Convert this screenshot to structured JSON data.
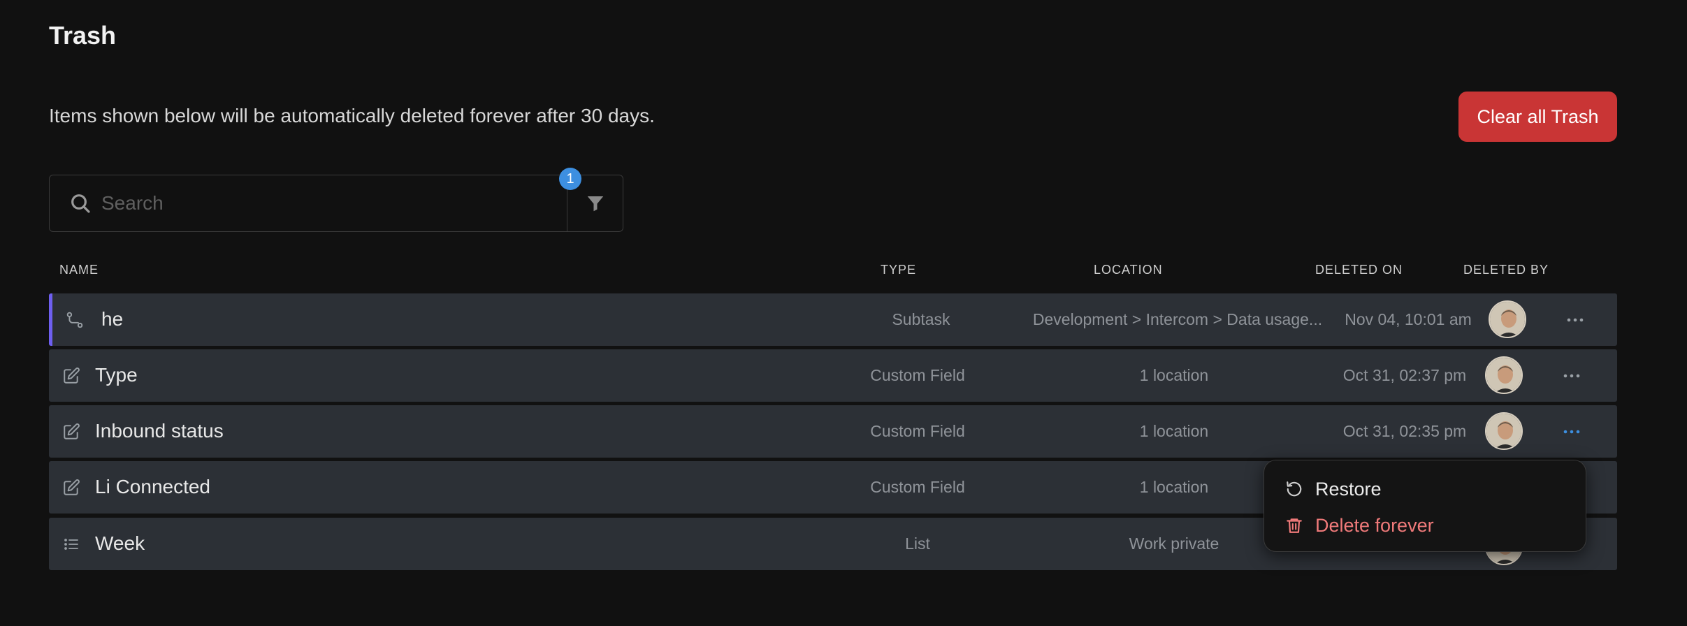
{
  "page": {
    "title": "Trash",
    "notice": "Items shown below will be automatically deleted forever after 30 days.",
    "clear_button": "Clear all Trash"
  },
  "search": {
    "placeholder": "Search",
    "filter_count": "1"
  },
  "columns": {
    "name": "NAME",
    "type": "TYPE",
    "location": "LOCATION",
    "deleted_on": "DELETED ON",
    "deleted_by": "DELETED BY"
  },
  "rows": [
    {
      "icon": "subtask-icon",
      "name": "he",
      "type": "Subtask",
      "location": "Development > Intercom > Data usage...",
      "deleted_on": "Nov 04, 10:01 am"
    },
    {
      "icon": "edit-icon",
      "name": "Type",
      "type": "Custom Field",
      "location": "1 location",
      "deleted_on": "Oct 31, 02:37 pm"
    },
    {
      "icon": "edit-icon",
      "name": "Inbound status",
      "type": "Custom Field",
      "location": "1 location",
      "deleted_on": "Oct 31, 02:35 pm"
    },
    {
      "icon": "edit-icon",
      "name": "Li Connected",
      "type": "Custom Field",
      "location": "1 location",
      "deleted_on": ""
    },
    {
      "icon": "list-icon",
      "name": "Week",
      "type": "List",
      "location": "Work private",
      "deleted_on": ""
    }
  ],
  "context_menu": {
    "restore": "Restore",
    "delete_forever": "Delete forever"
  },
  "colors": {
    "background": "#111111",
    "row": "#2c3036",
    "danger": "#c93535",
    "danger_text": "#f07a7a",
    "accent": "#3d8fe0",
    "active_row_border": "#6e5ff0"
  }
}
